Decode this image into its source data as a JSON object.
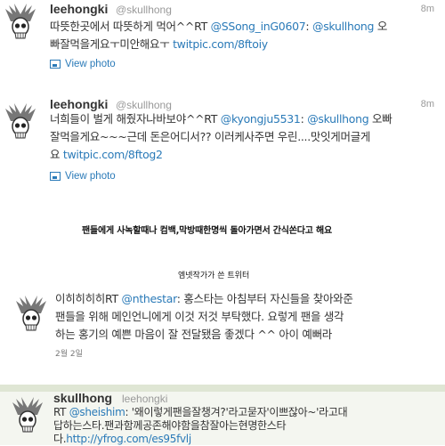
{
  "tweets": [
    {
      "username": "leehongki",
      "handle": "@skullhong",
      "time": "8m",
      "line1_text": "따뜻한곳에서 따뜻하게 먹어^^RT ",
      "line1_mention": "@SSong_inG0607",
      "line1_rest": ": ",
      "line1_mention2": "@skullhong",
      "line1_tail": " 오",
      "line2_text": "빠잘먹을게요ㅜ미안해요ㅜ ",
      "line2_link": "twitpic.com/8ftoiy",
      "view_photo": "View photo"
    },
    {
      "username": "leehongki",
      "handle": "@skullhong",
      "time": "8m",
      "line1_text": "너희들이 벌게 해줬자나바보야^^RT ",
      "line1_mention": "@kyongju5531",
      "line1_rest": ": ",
      "line1_mention2": "@skullhong",
      "line1_tail": " 오빠",
      "line2_text": "잘먹을게요~~~근데 돈은어디서?? 이러케사주면 우린....맛잇게머글게",
      "line3_text": "요 ",
      "line3_link": "twitpic.com/8ftog2",
      "view_photo": "View photo"
    }
  ],
  "caption_main": "팬들에게 사녹할때나 컴백,막방때한명씩 돌아가면서 간식쏜다고 해요",
  "caption_sub": "엠넷작가가 쓴 트위터",
  "tweet3": {
    "line1_text": "이히히히히RT ",
    "line1_mention": "@nthestar",
    "line1_rest": ": 홍스타는 아침부터 자신들을 찾아와준",
    "line2_text": "팬들을 위해 메인언니에게 이것 저것 부탁했다. 요렇게 팬을 생각",
    "line3_text": "하는 홍기의 예쁜 마음이 잘 전달됐음 좋겠다 ^^ 아이 예뻐라",
    "date": "2월 2일"
  },
  "tweet4": {
    "username": "skullhong",
    "handle": "leehongki",
    "line1_text": "RT ",
    "line1_mention": "@sheishim",
    "line1_rest": ": '왜이렇게팬을잘챙겨?'라고묻자'이쁘잖아~'라고대",
    "line2_text": "답하는스타.팬과함께공존해야함을참잘아는현명한스타",
    "line3_text": "다.",
    "line3_link": "http://yfrog.com/es95fvlj"
  }
}
